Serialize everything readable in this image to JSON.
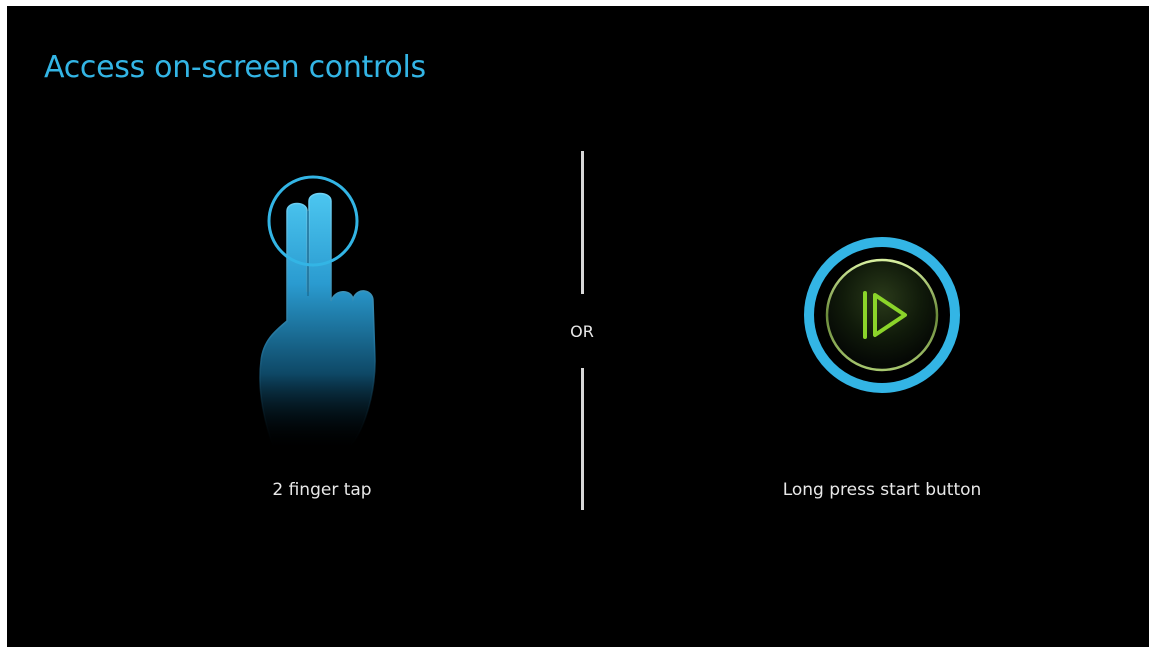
{
  "title": "Access on-screen controls",
  "options": {
    "left": {
      "caption": "2 finger tap",
      "icon": "two-finger-tap-hand-icon"
    },
    "divider_label": "OR",
    "right": {
      "caption": "Long press start button",
      "icon": "play-start-button-icon"
    }
  },
  "colors": {
    "background": "#000000",
    "accent_blue": "#33b5e5",
    "play_green": "#8bd42a",
    "text": "#e8e8e8"
  }
}
